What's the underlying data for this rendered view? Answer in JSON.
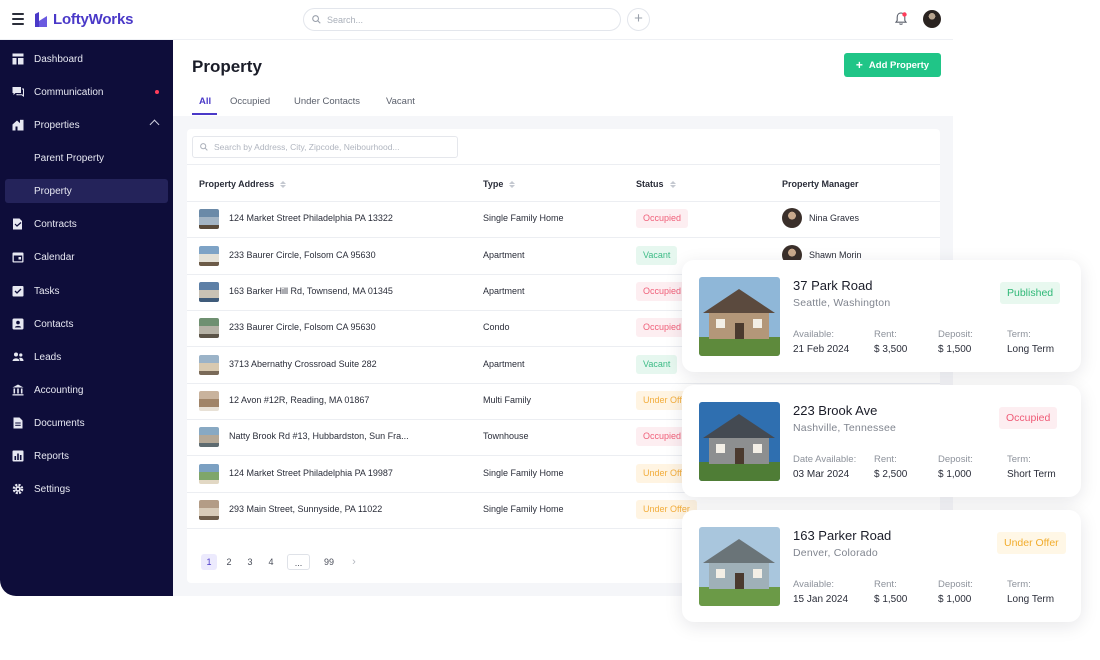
{
  "app": {
    "name": "LoftyWorks"
  },
  "topbar": {
    "search_placeholder": "Search..."
  },
  "sidebar": {
    "items": [
      {
        "label": "Dashboard",
        "icon": "dashboard-icon"
      },
      {
        "label": "Communication",
        "icon": "chat-icon",
        "has_dot": true
      },
      {
        "label": "Properties",
        "icon": "building-icon",
        "expanded": true
      },
      {
        "label": "Parent Property",
        "sub": true
      },
      {
        "label": "Property",
        "sub": true,
        "active": true
      },
      {
        "label": "Contracts",
        "icon": "contract-icon"
      },
      {
        "label": "Calendar",
        "icon": "calendar-icon"
      },
      {
        "label": "Tasks",
        "icon": "tasks-icon"
      },
      {
        "label": "Contacts",
        "icon": "contacts-icon"
      },
      {
        "label": "Leads",
        "icon": "leads-icon"
      },
      {
        "label": "Accounting",
        "icon": "bank-icon"
      },
      {
        "label": "Documents",
        "icon": "document-icon"
      },
      {
        "label": "Reports",
        "icon": "reports-icon"
      },
      {
        "label": "Settings",
        "icon": "gear-icon"
      }
    ]
  },
  "page": {
    "title": "Property",
    "add_button": "Add Property",
    "tabs": [
      "All",
      "Occupied",
      "Under Contacts",
      "Vacant"
    ],
    "active_tab": "All"
  },
  "table": {
    "search_placeholder": "Search by Address, City, Zipcode, Neibourhood...",
    "columns": [
      "Property Address",
      "Type",
      "Status",
      "Property Manager"
    ],
    "rows": [
      {
        "address": "124 Market Street Philadelphia PA 13322",
        "type": "Single Family Home",
        "status": "Occupied",
        "manager": "Nina Graves"
      },
      {
        "address": "233 Baurer Circle, Folsom CA 95630",
        "type": "Apartment",
        "status": "Vacant",
        "manager": "Shawn Morin"
      },
      {
        "address": "163 Barker Hill Rd, Townsend, MA 01345",
        "type": "Apartment",
        "status": "Occupied",
        "manager": ""
      },
      {
        "address": "233 Baurer Circle, Folsom CA 95630",
        "type": "Condo",
        "status": "Occupied",
        "manager": ""
      },
      {
        "address": "3713 Abernathy Crossroad Suite 282",
        "type": "Apartment",
        "status": "Vacant",
        "manager": ""
      },
      {
        "address": "12 Avon #12R, Reading, MA 01867",
        "type": "Multi Family",
        "status": "Under Offer",
        "manager": ""
      },
      {
        "address": "Natty Brook Rd #13, Hubbardston, Sun Fra...",
        "type": "Townhouse",
        "status": "Occupied",
        "manager": ""
      },
      {
        "address": "124 Market Street Philadelphia PA 19987",
        "type": "Single Family Home",
        "status": "Under Offer",
        "manager": ""
      },
      {
        "address": "293 Main Street, Sunnyside, PA 11022",
        "type": "Single Family Home",
        "status": "Under Offer",
        "manager": ""
      }
    ],
    "pagination": [
      "1",
      "2",
      "3",
      "4",
      "...",
      "99"
    ],
    "current_page": "1"
  },
  "listings": [
    {
      "address": "37 Park Road",
      "city": "Seattle, Washington",
      "status": "Published",
      "available_label": "Available:",
      "available": "21 Feb 2024",
      "rent_label": "Rent:",
      "rent": "$ 3,500",
      "deposit_label": "Deposit:",
      "deposit": "$ 1,500",
      "term_label": "Term:",
      "term": "Long Term"
    },
    {
      "address": "223 Brook Ave",
      "city": "Nashville, Tennessee",
      "status": "Occupied",
      "available_label": "Date Available:",
      "available": "03 Mar 2024",
      "rent_label": "Rent:",
      "rent": "$ 2,500",
      "deposit_label": "Deposit:",
      "deposit": "$ 1,000",
      "term_label": "Term:",
      "term": "Short Term"
    },
    {
      "address": "163 Parker Road",
      "city": "Denver, Colorado",
      "status": "Under Offer",
      "available_label": "Available:",
      "available": "15 Jan 2024",
      "rent_label": "Rent:",
      "rent": "$ 1,500",
      "deposit_label": "Deposit:",
      "deposit": "$ 1,000",
      "term_label": "Term:",
      "term": "Long Term"
    }
  ],
  "colors": {
    "brand": "#4a39c8",
    "sidebar_bg": "#0e0d3a",
    "accent_green": "#20c587",
    "occupied": "#f0607a",
    "vacant": "#3dbb86",
    "under_offer": "#f2ad3c"
  }
}
